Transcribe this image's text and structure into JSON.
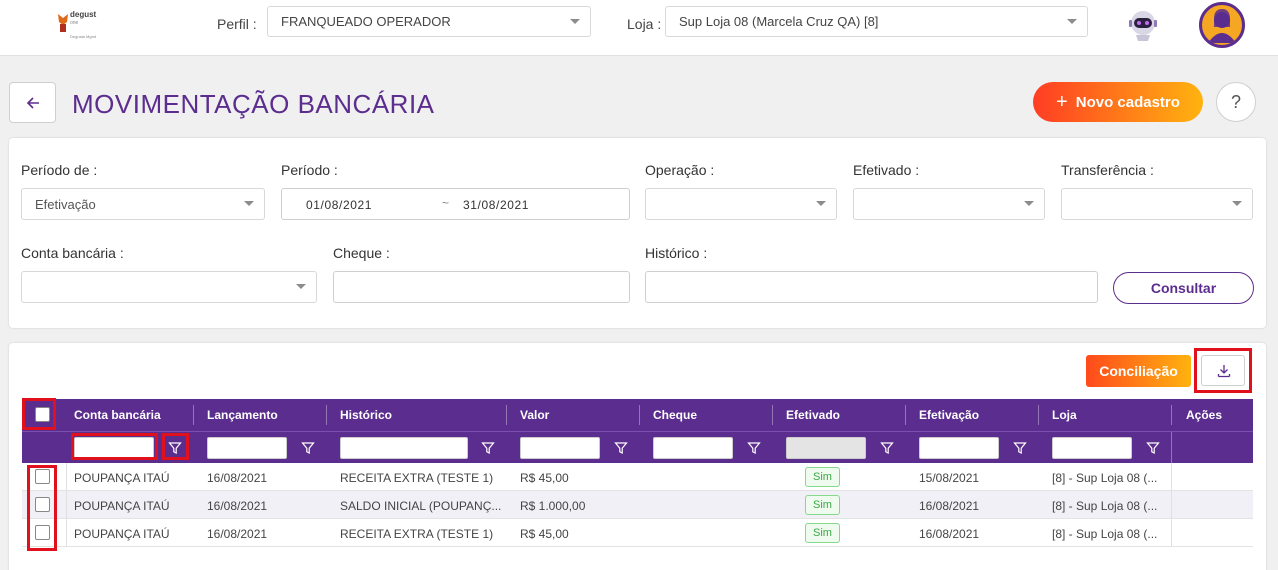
{
  "topbar": {
    "logo": {
      "brand": "degust",
      "sub": "one",
      "sub2": "Degusta Mgmt"
    },
    "perfil_label": "Perfil",
    "perfil_value": "FRANQUEADO OPERADOR",
    "loja_label": "Loja",
    "loja_value": "Sup Loja 08 (Marcela Cruz QA) [8]"
  },
  "header": {
    "title": "MOVIMENTAÇÃO BANCÁRIA",
    "novo_label": "Novo cadastro",
    "help_label": "?"
  },
  "filters": {
    "periodo_de_label": "Período de",
    "periodo_de_value": "Efetivação",
    "periodo_label": "Período",
    "periodo_start": "01/08/2021",
    "periodo_sep": "~",
    "periodo_end": "31/08/2021",
    "operacao_label": "Operação",
    "efetivado_label": "Efetivado",
    "transferencia_label": "Transferência",
    "conta_label": "Conta bancária",
    "cheque_label": "Cheque",
    "historico_label": "Histórico",
    "consultar_label": "Consultar"
  },
  "table": {
    "conciliacao_label": "Conciliação",
    "columns": [
      "Conta bancária",
      "Lançamento",
      "Histórico",
      "Valor",
      "Cheque",
      "Efetivado",
      "Efetivação",
      "Loja",
      "Ações"
    ],
    "rows": [
      {
        "conta": "POUPANÇA ITAÚ",
        "lancamento": "16/08/2021",
        "historico": "RECEITA EXTRA (TESTE 1)",
        "valor": "R$ 45,00",
        "cheque": "",
        "efetivado": "Sim",
        "efetivacao": "15/08/2021",
        "loja": "[8] - Sup Loja 08 (..."
      },
      {
        "conta": "POUPANÇA ITAÚ",
        "lancamento": "16/08/2021",
        "historico": "SALDO INICIAL (POUPANÇ...",
        "valor": "R$ 1.000,00",
        "cheque": "",
        "efetivado": "Sim",
        "efetivacao": "16/08/2021",
        "loja": "[8] - Sup Loja 08 (..."
      },
      {
        "conta": "POUPANÇA ITAÚ",
        "lancamento": "16/08/2021",
        "historico": "RECEITA EXTRA (TESTE 1)",
        "valor": "R$ 45,00",
        "cheque": "",
        "efetivado": "Sim",
        "efetivacao": "16/08/2021",
        "loja": "[8] - Sup Loja 08 (..."
      }
    ]
  },
  "colors": {
    "primary": "#5b2d8e",
    "accent_start": "#ff3d24",
    "accent_end": "#ffb30f",
    "highlight": "#e0101c",
    "success": "#3aa845"
  },
  "icons": [
    "back-arrow-icon",
    "plus-icon",
    "help-icon",
    "chevron-down-icon",
    "download-icon",
    "filter-icon",
    "checkbox-icon",
    "robot-icon",
    "user-avatar-icon"
  ]
}
